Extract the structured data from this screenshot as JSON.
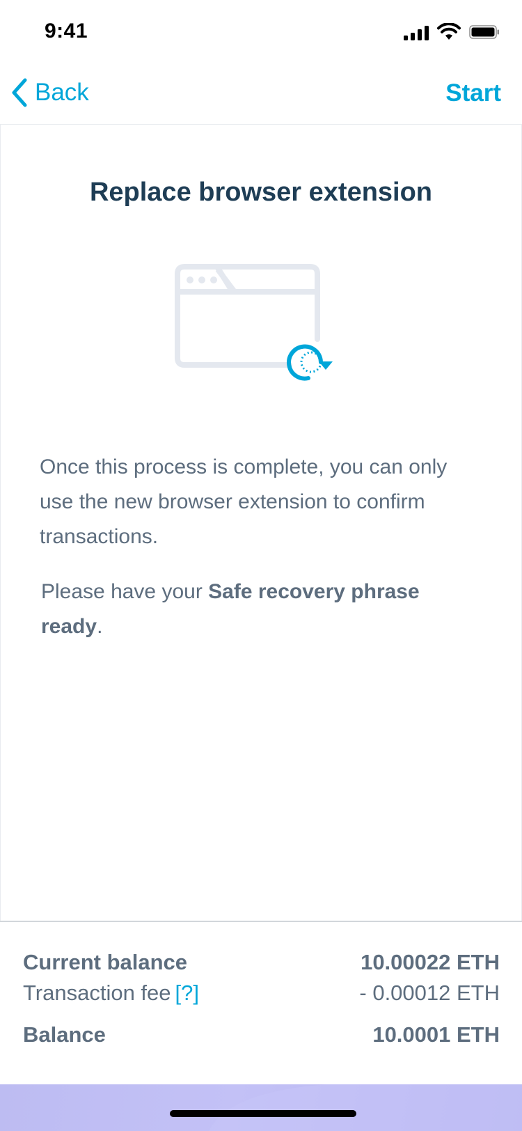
{
  "status_bar": {
    "time": "9:41",
    "icons": [
      "cellular-signal-icon",
      "wifi-icon",
      "battery-icon"
    ]
  },
  "nav": {
    "back_label": "Back",
    "back_icon": "chevron-left-icon",
    "start_label": "Start"
  },
  "main": {
    "title": "Replace browser extension",
    "illustration_icons": [
      "browser-window-icon",
      "refresh-arrow-icon"
    ],
    "paragraph_1": "Once this process is complete, you can only use the new browser extension to confirm transactions.",
    "paragraph_2": {
      "prefix": "Please have your ",
      "strong": "Safe recovery phrase ready",
      "suffix": "."
    }
  },
  "summary": {
    "current_balance_label": "Current balance",
    "current_balance_value": "10.00022 ETH",
    "fee_label": "Transaction fee",
    "fee_help": "[?]",
    "fee_value": "- 0.00012 ETH",
    "balance_label": "Balance",
    "balance_value": "10.0001 ETH"
  },
  "colors": {
    "accent": "#00a6d9",
    "title": "#1e3d55",
    "body_text": "#5d6d7e",
    "illustration_gray": "#e4e8ef",
    "home_area": "#bdbcf2"
  }
}
